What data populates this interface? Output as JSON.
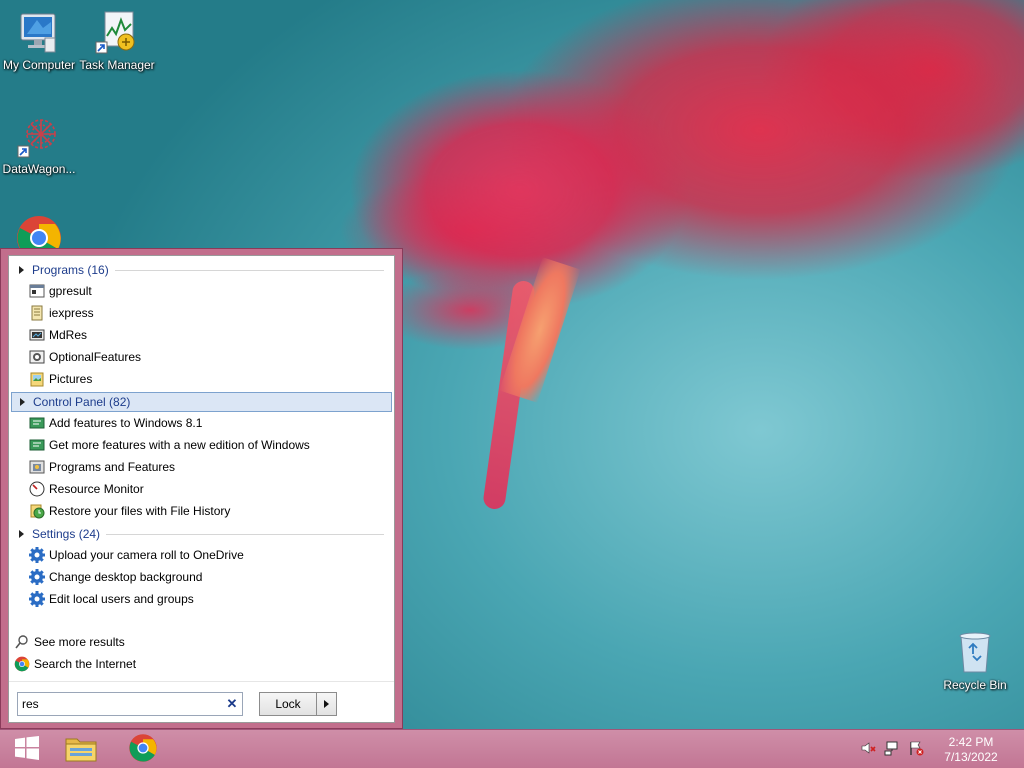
{
  "desktop": {
    "icons": [
      {
        "label": "My Computer",
        "icon": "computer-icon"
      },
      {
        "label": "Task Manager",
        "icon": "task-manager-icon"
      },
      {
        "label": "DataWagon...",
        "icon": "datawagon-icon"
      },
      {
        "label": "",
        "icon": "chrome-icon"
      },
      {
        "label": "Recycle Bin",
        "icon": "recycle-bin-icon"
      }
    ]
  },
  "start_panel": {
    "groups": [
      {
        "label": "Programs (16)",
        "items": [
          "gpresult",
          "iexpress",
          "MdRes",
          "OptionalFeatures",
          "Pictures"
        ]
      },
      {
        "label": "Control Panel (82)",
        "selected": true,
        "items": [
          "Add features to Windows 8.1",
          "Get more features with a new edition of Windows",
          "Programs and Features",
          "Resource Monitor",
          "Restore your files with File History"
        ]
      },
      {
        "label": "Settings (24)",
        "items": [
          "Upload your camera roll to OneDrive",
          "Change desktop background",
          "Edit local users and groups"
        ]
      }
    ],
    "see_more": "See more results",
    "search_internet": "Search the Internet",
    "search_value": "res",
    "lock_label": "Lock"
  },
  "taskbar": {
    "clock_time": "2:42 PM",
    "clock_date": "7/13/2022",
    "pinned": [
      "windows-start-icon",
      "file-explorer-icon",
      "chrome-icon"
    ],
    "tray_icons": [
      "speaker-muted-icon",
      "network-icon",
      "action-center-icon"
    ]
  },
  "colors": {
    "panel_border": "#c26e8c",
    "taskbar": "#c97f9c",
    "group_text": "#1e3d8c",
    "selection": "#dbe6f5"
  }
}
